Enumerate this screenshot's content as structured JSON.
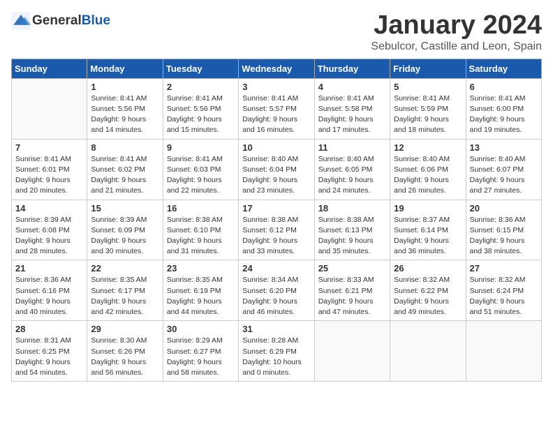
{
  "header": {
    "logo_general": "General",
    "logo_blue": "Blue",
    "month": "January 2024",
    "location": "Sebulcor, Castille and Leon, Spain"
  },
  "weekdays": [
    "Sunday",
    "Monday",
    "Tuesday",
    "Wednesday",
    "Thursday",
    "Friday",
    "Saturday"
  ],
  "weeks": [
    [
      {
        "day": "",
        "info": ""
      },
      {
        "day": "1",
        "info": "Sunrise: 8:41 AM\nSunset: 5:56 PM\nDaylight: 9 hours\nand 14 minutes."
      },
      {
        "day": "2",
        "info": "Sunrise: 8:41 AM\nSunset: 5:56 PM\nDaylight: 9 hours\nand 15 minutes."
      },
      {
        "day": "3",
        "info": "Sunrise: 8:41 AM\nSunset: 5:57 PM\nDaylight: 9 hours\nand 16 minutes."
      },
      {
        "day": "4",
        "info": "Sunrise: 8:41 AM\nSunset: 5:58 PM\nDaylight: 9 hours\nand 17 minutes."
      },
      {
        "day": "5",
        "info": "Sunrise: 8:41 AM\nSunset: 5:59 PM\nDaylight: 9 hours\nand 18 minutes."
      },
      {
        "day": "6",
        "info": "Sunrise: 8:41 AM\nSunset: 6:00 PM\nDaylight: 9 hours\nand 19 minutes."
      }
    ],
    [
      {
        "day": "7",
        "info": "Sunrise: 8:41 AM\nSunset: 6:01 PM\nDaylight: 9 hours\nand 20 minutes."
      },
      {
        "day": "8",
        "info": "Sunrise: 8:41 AM\nSunset: 6:02 PM\nDaylight: 9 hours\nand 21 minutes."
      },
      {
        "day": "9",
        "info": "Sunrise: 8:41 AM\nSunset: 6:03 PM\nDaylight: 9 hours\nand 22 minutes."
      },
      {
        "day": "10",
        "info": "Sunrise: 8:40 AM\nSunset: 6:04 PM\nDaylight: 9 hours\nand 23 minutes."
      },
      {
        "day": "11",
        "info": "Sunrise: 8:40 AM\nSunset: 6:05 PM\nDaylight: 9 hours\nand 24 minutes."
      },
      {
        "day": "12",
        "info": "Sunrise: 8:40 AM\nSunset: 6:06 PM\nDaylight: 9 hours\nand 26 minutes."
      },
      {
        "day": "13",
        "info": "Sunrise: 8:40 AM\nSunset: 6:07 PM\nDaylight: 9 hours\nand 27 minutes."
      }
    ],
    [
      {
        "day": "14",
        "info": "Sunrise: 8:39 AM\nSunset: 6:08 PM\nDaylight: 9 hours\nand 28 minutes."
      },
      {
        "day": "15",
        "info": "Sunrise: 8:39 AM\nSunset: 6:09 PM\nDaylight: 9 hours\nand 30 minutes."
      },
      {
        "day": "16",
        "info": "Sunrise: 8:38 AM\nSunset: 6:10 PM\nDaylight: 9 hours\nand 31 minutes."
      },
      {
        "day": "17",
        "info": "Sunrise: 8:38 AM\nSunset: 6:12 PM\nDaylight: 9 hours\nand 33 minutes."
      },
      {
        "day": "18",
        "info": "Sunrise: 8:38 AM\nSunset: 6:13 PM\nDaylight: 9 hours\nand 35 minutes."
      },
      {
        "day": "19",
        "info": "Sunrise: 8:37 AM\nSunset: 6:14 PM\nDaylight: 9 hours\nand 36 minutes."
      },
      {
        "day": "20",
        "info": "Sunrise: 8:36 AM\nSunset: 6:15 PM\nDaylight: 9 hours\nand 38 minutes."
      }
    ],
    [
      {
        "day": "21",
        "info": "Sunrise: 8:36 AM\nSunset: 6:16 PM\nDaylight: 9 hours\nand 40 minutes."
      },
      {
        "day": "22",
        "info": "Sunrise: 8:35 AM\nSunset: 6:17 PM\nDaylight: 9 hours\nand 42 minutes."
      },
      {
        "day": "23",
        "info": "Sunrise: 8:35 AM\nSunset: 6:19 PM\nDaylight: 9 hours\nand 44 minutes."
      },
      {
        "day": "24",
        "info": "Sunrise: 8:34 AM\nSunset: 6:20 PM\nDaylight: 9 hours\nand 46 minutes."
      },
      {
        "day": "25",
        "info": "Sunrise: 8:33 AM\nSunset: 6:21 PM\nDaylight: 9 hours\nand 47 minutes."
      },
      {
        "day": "26",
        "info": "Sunrise: 8:32 AM\nSunset: 6:22 PM\nDaylight: 9 hours\nand 49 minutes."
      },
      {
        "day": "27",
        "info": "Sunrise: 8:32 AM\nSunset: 6:24 PM\nDaylight: 9 hours\nand 51 minutes."
      }
    ],
    [
      {
        "day": "28",
        "info": "Sunrise: 8:31 AM\nSunset: 6:25 PM\nDaylight: 9 hours\nand 54 minutes."
      },
      {
        "day": "29",
        "info": "Sunrise: 8:30 AM\nSunset: 6:26 PM\nDaylight: 9 hours\nand 56 minutes."
      },
      {
        "day": "30",
        "info": "Sunrise: 8:29 AM\nSunset: 6:27 PM\nDaylight: 9 hours\nand 58 minutes."
      },
      {
        "day": "31",
        "info": "Sunrise: 8:28 AM\nSunset: 6:29 PM\nDaylight: 10 hours\nand 0 minutes."
      },
      {
        "day": "",
        "info": ""
      },
      {
        "day": "",
        "info": ""
      },
      {
        "day": "",
        "info": ""
      }
    ]
  ]
}
